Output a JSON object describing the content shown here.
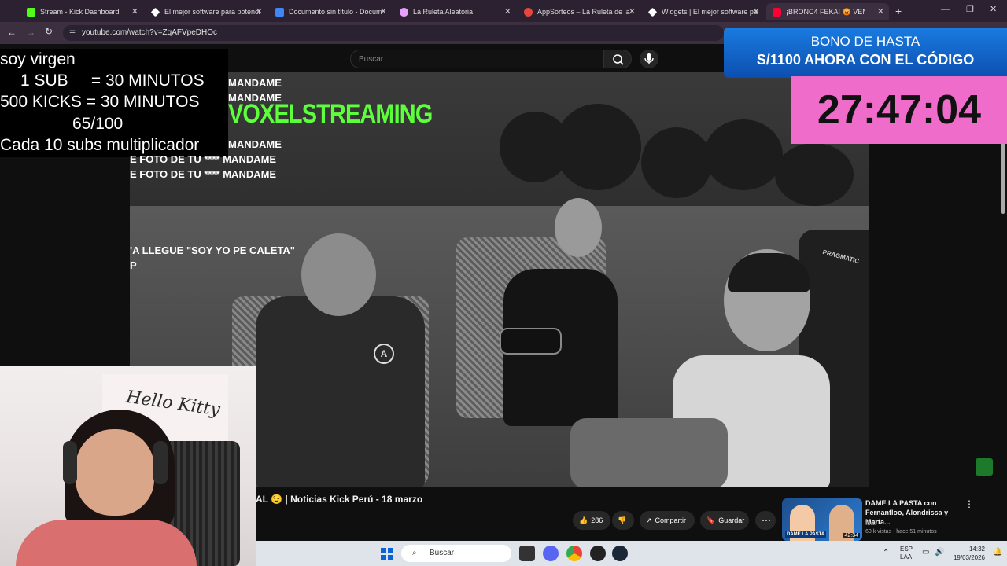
{
  "browser": {
    "tabs": [
      {
        "title": "Stream - Kick Dashboard",
        "color": "#53fc18"
      },
      {
        "title": "El mejor software para potenci",
        "color": "#ffffff"
      },
      {
        "title": "Documento sin título - Docum",
        "color": "#4285f4"
      },
      {
        "title": "La Ruleta Aleatoria",
        "color": "#e5a0ff"
      },
      {
        "title": "AppSorteos – La Ruleta de la S",
        "color": "#e8453c"
      },
      {
        "title": "Widgets | El mejor software par",
        "color": "#ffffff"
      },
      {
        "title": "¡BRONC4 FEKA! 😡 VEN",
        "color": "#ff0033"
      }
    ],
    "url": "youtube.com/watch?v=ZqAFVpeDHOc"
  },
  "youtube": {
    "search_placeholder": "Buscar",
    "video_title": "AL 😉 | Noticias Kick Perú - 18 marzo",
    "likes": "286",
    "share_label": "Compartir",
    "save_label": "Guardar",
    "recommendation": {
      "title": "DAME LA PASTA con Fernanfloo, Alondrissa y Marta...",
      "channel": "Ibai",
      "meta": "60 k vistas · hace 51 minutos",
      "duration": "42:34",
      "thumb_text": "DAME LA PASTA"
    }
  },
  "overlay": {
    "sub_lines": [
      "soy virgen",
      "1 SUB     = 30 MINUTOS",
      "500 KICKS = 30 MINUTOS",
      "65/100",
      "Cada 10 subs multiplicador"
    ],
    "chat_lines": [
      "MANDAME",
      "MANDAME",
      "MANDAME",
      "E FOTO DE TU **** MANDAME",
      "E FOTO DE TU **** MANDAME",
      "'A LLEGUE \"SOY YO PE CALETA\"",
      "P"
    ],
    "brand": "VOXELSTREAMING",
    "bono_line1": "BONO DE HASTA",
    "bono_line2": "S/1100 AHORA CON EL CÓDIGO",
    "timer": "27:47:04",
    "webcam_wall_text": "Hello Kitty",
    "chair_brand": "PRAGMATIC"
  },
  "taskbar": {
    "search_placeholder": "Buscar",
    "lang1": "ESP",
    "lang2": "LAA",
    "time": "14:32",
    "date": "19/03/2026"
  }
}
